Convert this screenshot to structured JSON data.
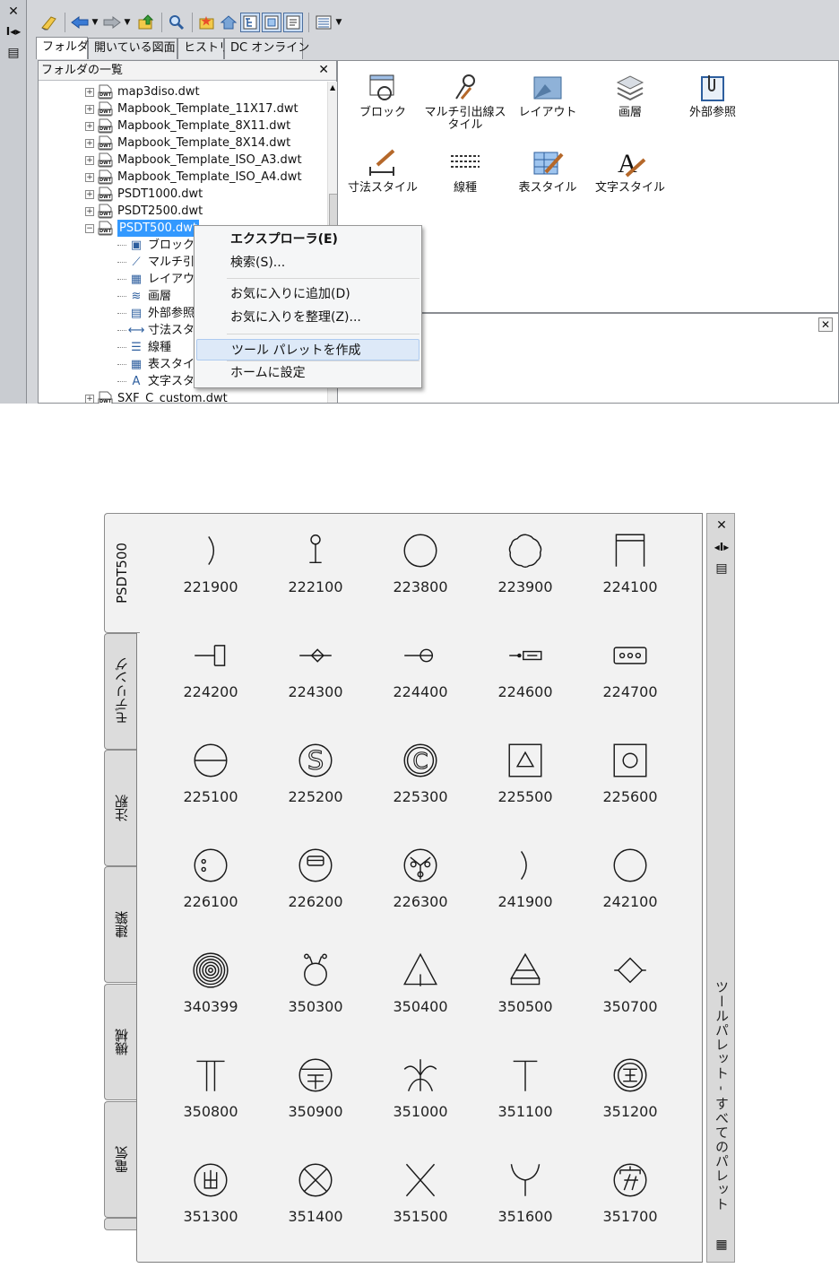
{
  "design_center": {
    "toolbar": {
      "buttons": [
        "load-icon",
        "back-icon",
        "dropdown-icon",
        "forward-icon",
        "dropdown-icon",
        "up-icon",
        "search-icon",
        "favorites-icon",
        "home-icon",
        "tree-toggle-icon",
        "preview-icon",
        "description-icon",
        "views-icon",
        "dropdown-icon"
      ]
    },
    "tabs": [
      "フォルダ",
      "開いている図面",
      "ヒストリ",
      "DC オンライン"
    ],
    "tree": {
      "header": "フォルダの一覧",
      "files": [
        "map3diso.dwt",
        "Mapbook_Template_11X17.dwt",
        "Mapbook_Template_8X11.dwt",
        "Mapbook_Template_8X14.dwt",
        "Mapbook_Template_ISO_A3.dwt",
        "Mapbook_Template_ISO_A4.dwt",
        "PSDT1000.dwt",
        "PSDT2500.dwt"
      ],
      "selected_file": "PSDT500.dwt",
      "children": [
        "ブロック",
        "マルチ引出",
        "レイアウト",
        "画層",
        "外部参照",
        "寸法スタイ",
        "線種",
        "表スタイル",
        "文字スタイ"
      ],
      "last_file": "SXF_C_custom.dwt",
      "file_badge": "DWT"
    },
    "content_items": [
      {
        "label": "ブロック",
        "icon": "block-icon"
      },
      {
        "label": "マルチ引出線ス\nタイル",
        "icon": "multileader-style-icon"
      },
      {
        "label": "レイアウト",
        "icon": "layout-icon"
      },
      {
        "label": "画層",
        "icon": "layer-icon"
      },
      {
        "label": "外部参照",
        "icon": "xref-icon"
      },
      {
        "label": "寸法スタイル",
        "icon": "dimension-style-icon"
      },
      {
        "label": "線種",
        "icon": "linetype-icon"
      },
      {
        "label": "表スタイル",
        "icon": "table-style-icon"
      },
      {
        "label": "文字スタイル",
        "icon": "text-style-icon"
      }
    ],
    "context_menu": {
      "items": [
        {
          "label": "エクスプローラ(E)",
          "bold": true
        },
        {
          "label": "検索(S)..."
        },
        {
          "label": "お気に入りに追加(D)"
        },
        {
          "label": "お気に入りを整理(Z)..."
        },
        {
          "label": "ツール パレットを作成",
          "highlighted": true
        },
        {
          "label": "ホームに設定"
        }
      ]
    }
  },
  "tool_palette": {
    "title": "ツールパレット - すべてのパレット",
    "tabs": [
      "PSDT500",
      "モデリング",
      "注釈",
      "建築",
      "機械",
      "電気"
    ],
    "active_tab": "PSDT500",
    "items": [
      "221900",
      "222100",
      "223800",
      "223900",
      "224100",
      "224200",
      "224300",
      "224400",
      "224600",
      "224700",
      "225100",
      "225200",
      "225300",
      "225500",
      "225600",
      "226100",
      "226200",
      "226300",
      "241900",
      "242100",
      "340399",
      "350300",
      "350400",
      "350500",
      "350700",
      "350800",
      "350900",
      "351000",
      "351100",
      "351200",
      "351300",
      "351400",
      "351500",
      "351600",
      "351700"
    ]
  },
  "colors": {
    "selection": "#3399ff",
    "menu_highlight": "#dde9f8"
  }
}
